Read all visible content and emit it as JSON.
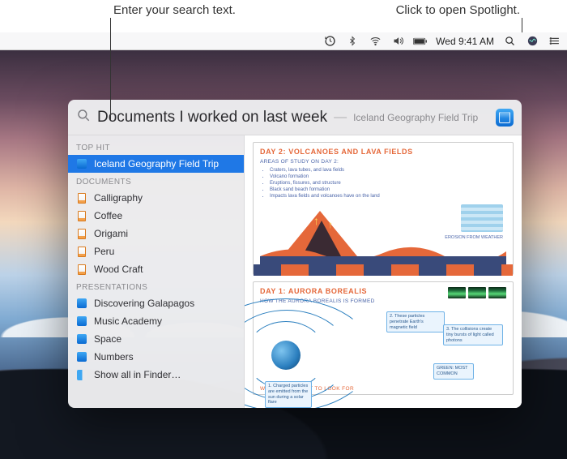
{
  "annotations": {
    "left": "Enter your search text.",
    "right": "Click to open Spotlight."
  },
  "menubar": {
    "clock": "Wed 9:41 AM"
  },
  "spotlight": {
    "query": "Documents I worked on last week",
    "top_hit_inline": "Iceland Geography Field Trip",
    "sections": [
      {
        "header": "TOP HIT",
        "items": [
          {
            "label": "Iceland Geography Field Trip",
            "icon": "keynote",
            "selected": true
          }
        ]
      },
      {
        "header": "DOCUMENTS",
        "items": [
          {
            "label": "Calligraphy",
            "icon": "pages"
          },
          {
            "label": "Coffee",
            "icon": "pages"
          },
          {
            "label": "Origami",
            "icon": "pages"
          },
          {
            "label": "Peru",
            "icon": "pages"
          },
          {
            "label": "Wood Craft",
            "icon": "pages"
          }
        ]
      },
      {
        "header": "PRESENTATIONS",
        "items": [
          {
            "label": "Discovering Galapagos",
            "icon": "keynote"
          },
          {
            "label": "Music Academy",
            "icon": "keynote"
          },
          {
            "label": "Space",
            "icon": "keynote"
          },
          {
            "label": "Numbers",
            "icon": "keynote"
          },
          {
            "label": "Show all in Finder…",
            "icon": "finder"
          }
        ]
      }
    ],
    "preview": {
      "slide1": {
        "title": "DAY 2: VOLCANOES AND LAVA FIELDS",
        "subheader": "AREAS OF STUDY ON DAY 2:",
        "bullets": [
          "Craters, lava tubes, and lava fields",
          "Volcano formation",
          "Eruptions, fissures, and structure",
          "Black sand beach formation",
          "Impacts lava fields and volcanoes have on the land"
        ],
        "weather_label": "EROSION FROM WEATHER"
      },
      "slide2": {
        "title": "DAY 1: AURORA BOREALIS",
        "subheader": "HOW THE AURORA BOREALIS IS FORMED",
        "note1": "1. Charged particles are emitted from the sun during a solar flare",
        "note2": "2. These particles penetrate Earth's magnetic field",
        "note3": "3. The collisions create tiny bursts of light called photons",
        "note4": "GREEN: MOST COMMON",
        "footer": "WHERE AND WHAT TO LOOK FOR"
      }
    }
  }
}
